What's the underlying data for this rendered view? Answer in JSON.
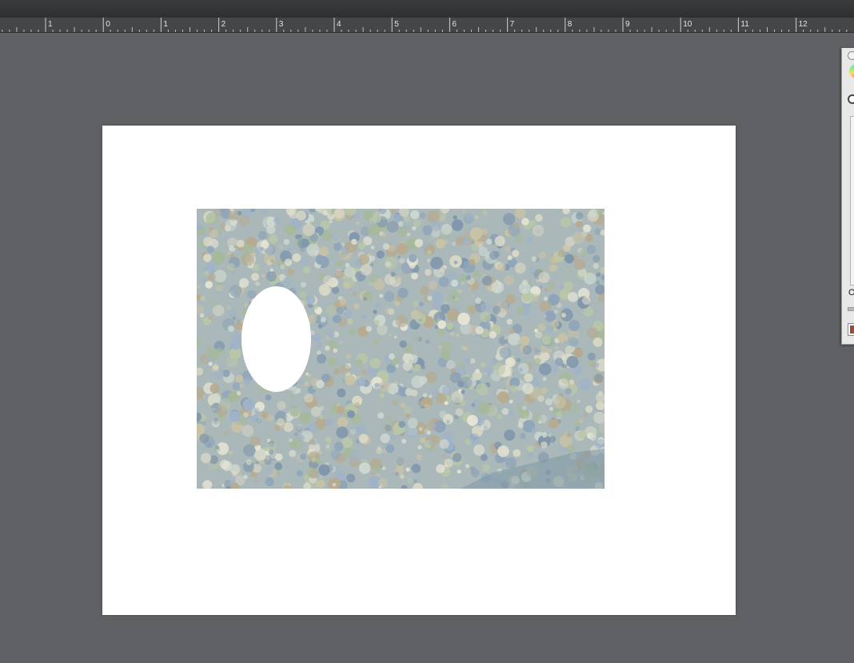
{
  "ruler": {
    "labels": [
      "1",
      "0",
      "1",
      "2",
      "3",
      "4",
      "5",
      "6",
      "7",
      "8",
      "9",
      "10",
      "11",
      "12"
    ]
  },
  "panel": {
    "partial_label": "O"
  },
  "colors": {
    "pasteboard": "#5f6063",
    "page": "#ffffff",
    "swatch": "#9a4a38"
  }
}
